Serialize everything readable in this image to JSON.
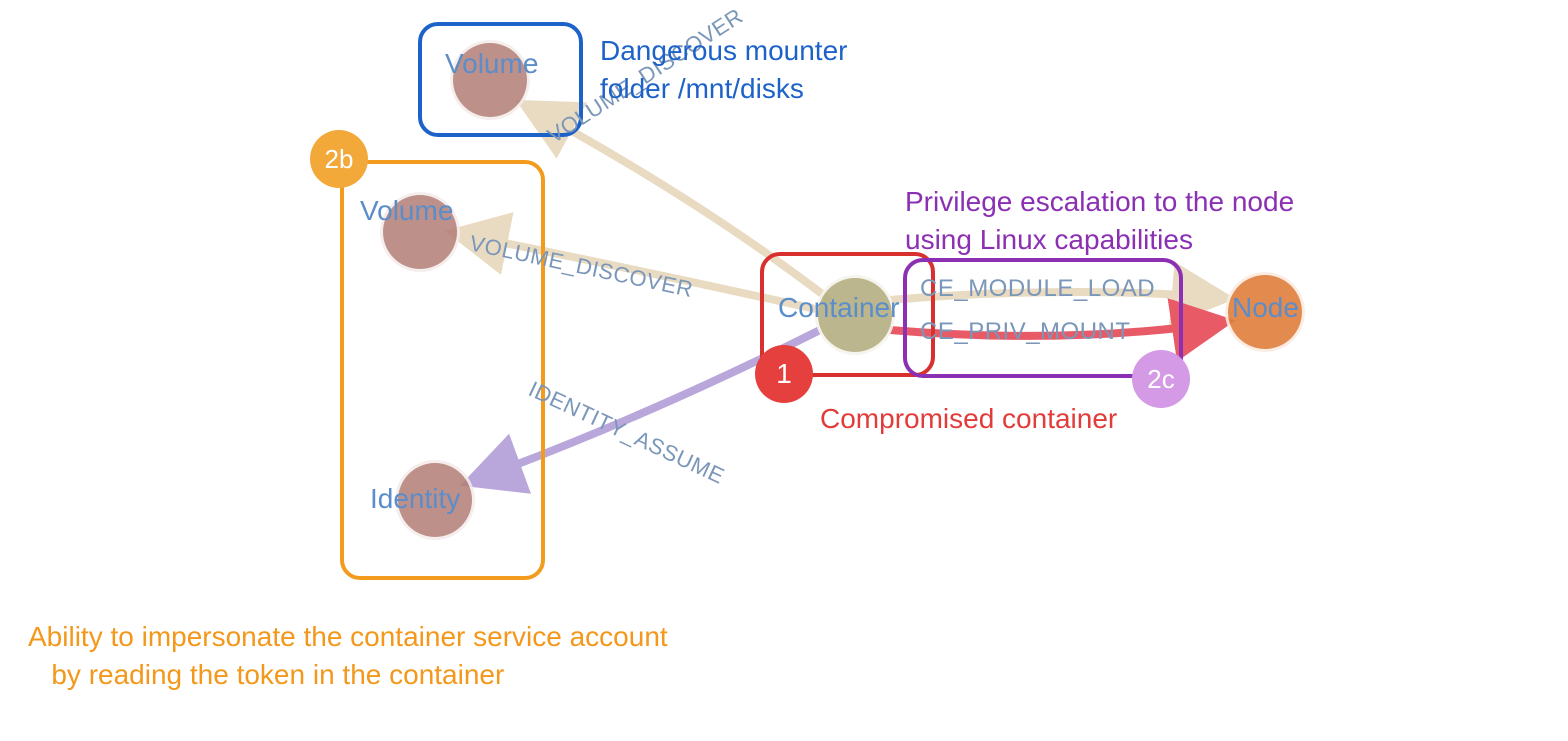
{
  "nodes": {
    "container": {
      "label": "Container"
    },
    "volume_top": {
      "label": "Volume"
    },
    "volume_mid": {
      "label": "Volume"
    },
    "identity": {
      "label": "Identity"
    },
    "node": {
      "label": "Node"
    }
  },
  "edges": {
    "volume_discover_top": {
      "label": "VOLUME_DISCOVER"
    },
    "volume_discover_mid": {
      "label": "VOLUME_DISCOVER"
    },
    "identity_assume": {
      "label": "IDENTITY_ASSUME"
    },
    "ce_module_load": {
      "label": "CE_MODULE_LOAD"
    },
    "ce_priv_mount": {
      "label": "CE_PRIV_MOUNT"
    }
  },
  "groups": {
    "compromised": {
      "badge": "1",
      "caption": "Compromised container"
    },
    "impersonate": {
      "badge": "2b",
      "caption": "Ability to impersonate the container service account\n   by reading the token in the container"
    },
    "privesc": {
      "badge": "2c",
      "caption": "Privilege escalation to the node\nusing Linux capabilities"
    },
    "mounter": {
      "caption": "Dangerous mounter\nfolder /mnt/disks"
    }
  },
  "colors": {
    "blue_text": "#5a8dc9",
    "blue_box": "#1d62c9",
    "orange_box": "#f39b1c",
    "orange_text": "#f3981a",
    "red_box": "#d8302e",
    "red_text": "#e13c3a",
    "purple_box": "#8b2fb3",
    "purple_text": "#8b2fb3",
    "node_brown": "#b37d76",
    "node_olive": "#b4af81",
    "node_orange": "#e07f3c",
    "badge_green": "#f3981a",
    "badge_pink": "#d49ae6",
    "edge_beige": "#e9dac2",
    "edge_red": "#e75a66",
    "edge_purple": "#b9a7dc"
  }
}
